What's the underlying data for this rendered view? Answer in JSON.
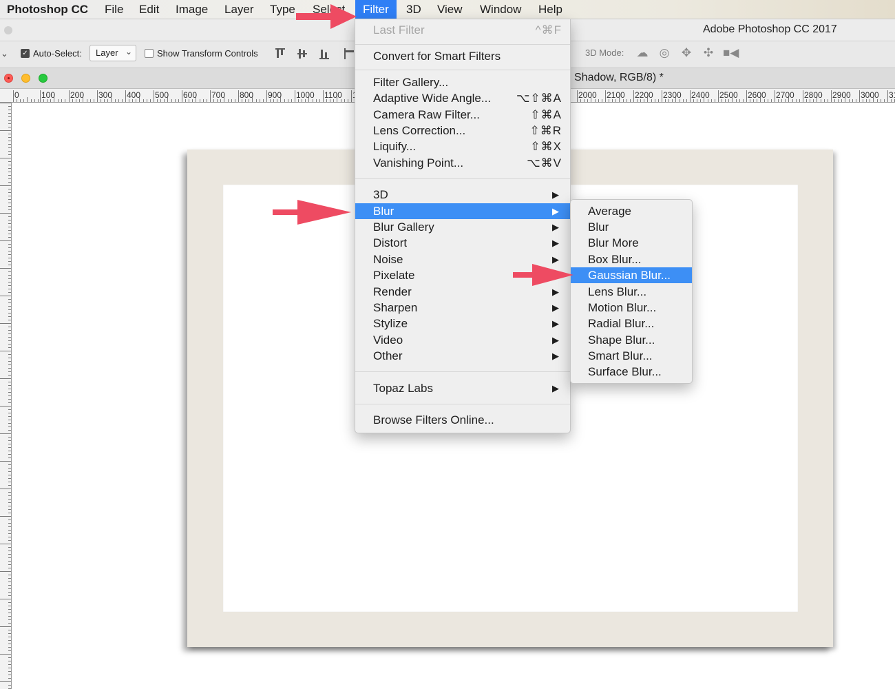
{
  "menubar": {
    "app": "Photoshop CC",
    "items": [
      "File",
      "Edit",
      "Image",
      "Layer",
      "Type",
      "Select",
      "Filter",
      "3D",
      "View",
      "Window",
      "Help"
    ],
    "active": "Filter"
  },
  "titlebar": {
    "title": "Adobe Photoshop CC 2017"
  },
  "options": {
    "auto_select_label": "Auto-Select:",
    "auto_select_checked": true,
    "auto_select_value": "Layer",
    "show_transform_label": "Show Transform Controls",
    "show_transform_checked": false,
    "mode_3d_label": "3D Mode:"
  },
  "document": {
    "title_partial": "Shadow, RGB/8) *"
  },
  "ruler": {
    "h_labels": [
      "0",
      "100",
      "200",
      "300",
      "400",
      "500",
      "600",
      "700",
      "800",
      "900",
      "1000",
      "1100",
      "1",
      "2000",
      "2100",
      "2200",
      "2300",
      "2400",
      "2500",
      "2600",
      "2700",
      "2800",
      "2900",
      "3000",
      "31"
    ]
  },
  "filter_menu": {
    "last_filter": {
      "label": "Last Filter",
      "shortcut": "^⌘F"
    },
    "convert": "Convert for Smart Filters",
    "gallery_items": [
      {
        "label": "Filter Gallery...",
        "shortcut": ""
      },
      {
        "label": "Adaptive Wide Angle...",
        "shortcut": "⌥⇧⌘A"
      },
      {
        "label": "Camera Raw Filter...",
        "shortcut": "⇧⌘A"
      },
      {
        "label": "Lens Correction...",
        "shortcut": "⇧⌘R"
      },
      {
        "label": "Liquify...",
        "shortcut": "⇧⌘X"
      },
      {
        "label": "Vanishing Point...",
        "shortcut": "⌥⌘V"
      }
    ],
    "submenus": [
      "3D",
      "Blur",
      "Blur Gallery",
      "Distort",
      "Noise",
      "Pixelate",
      "Render",
      "Sharpen",
      "Stylize",
      "Video",
      "Other"
    ],
    "highlighted": "Blur",
    "topaz": "Topaz Labs",
    "browse": "Browse Filters Online...",
    "arrow_glyph": "▶"
  },
  "blur_menu": {
    "items": [
      "Average",
      "Blur",
      "Blur More",
      "Box Blur...",
      "Gaussian Blur...",
      "Lens Blur...",
      "Motion Blur...",
      "Radial Blur...",
      "Shape Blur...",
      "Smart Blur...",
      "Surface Blur..."
    ],
    "highlighted": "Gaussian Blur..."
  },
  "colors": {
    "highlight": "#3d8ff5",
    "menubar_active": "#2f7ff5",
    "annotation_arrow": "#ee4b62",
    "frame": "#ebe7df"
  },
  "icons": {
    "checkbox_check": "✓",
    "dropdown_chevron": "⌄",
    "options_chevron": "⌄",
    "mode3d": [
      "orbit-icon",
      "roll-icon",
      "pan-icon",
      "slide-icon",
      "scale-icon"
    ]
  }
}
